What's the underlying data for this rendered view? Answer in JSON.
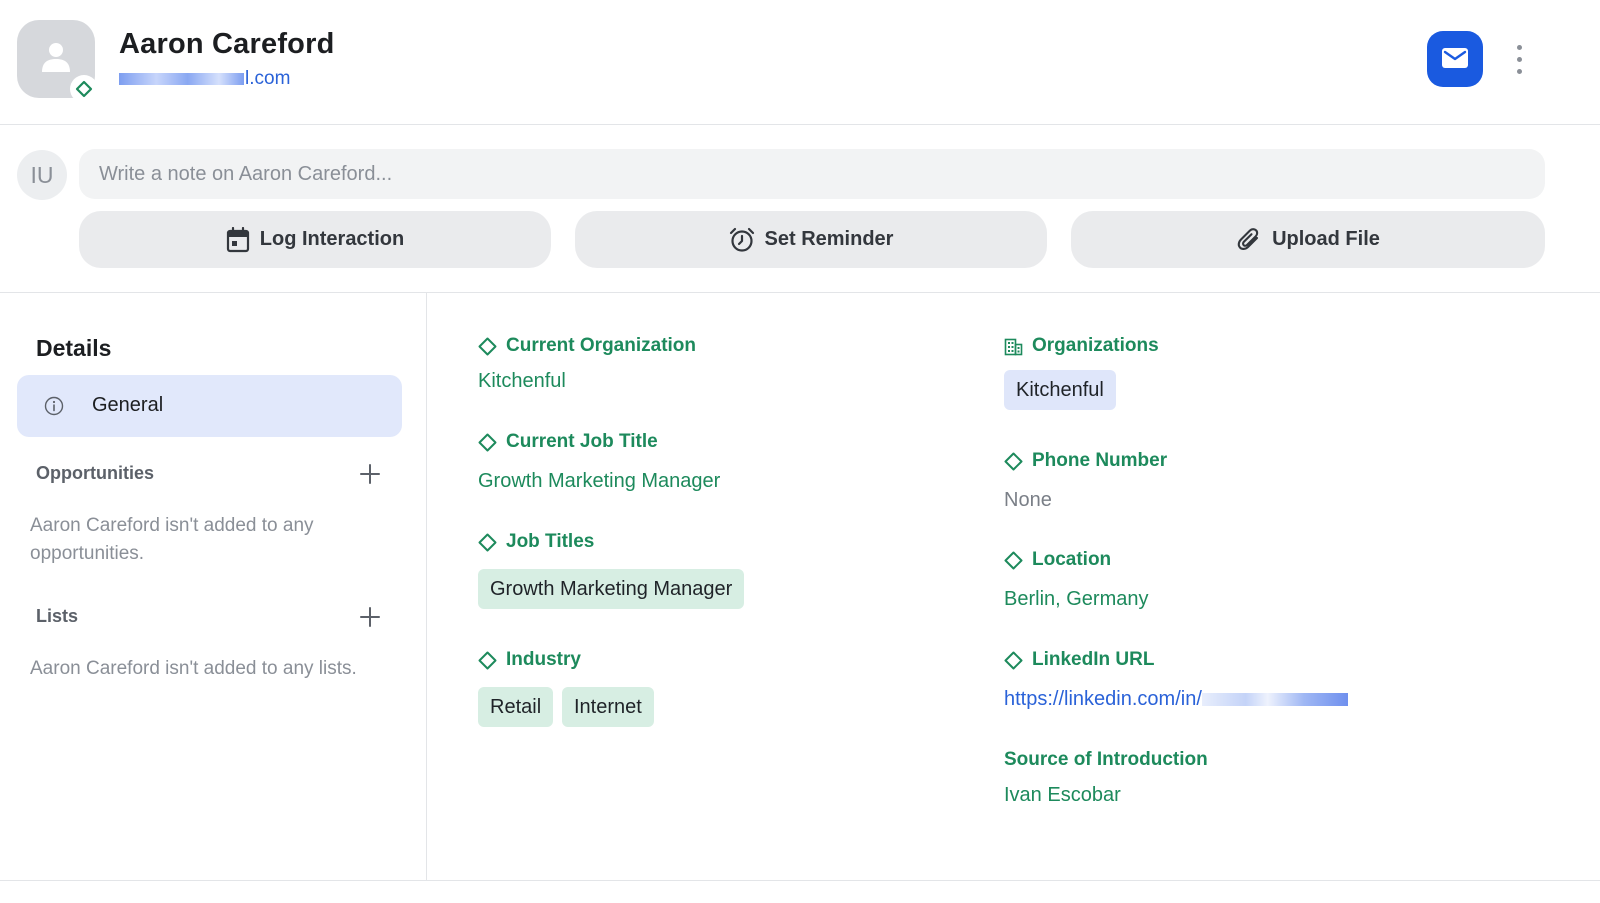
{
  "contact": {
    "name": "Aaron Careford",
    "email_suffix": "l.com"
  },
  "note": {
    "avatar_initials": "IU",
    "placeholder": "Write a note on Aaron Careford..."
  },
  "actions": {
    "log_interaction": "Log Interaction",
    "set_reminder": "Set Reminder",
    "upload_file": "Upload File"
  },
  "sidebar": {
    "title": "Details",
    "general_label": "General",
    "opportunities": {
      "title": "Opportunities",
      "empty_text": "Aaron Careford isn't added to any opportunities."
    },
    "lists": {
      "title": "Lists",
      "empty_text": "Aaron Careford isn't added to any lists."
    }
  },
  "fields": {
    "current_organization": {
      "label": "Current Organization",
      "value": "Kitchenful"
    },
    "current_job_title": {
      "label": "Current Job Title",
      "value": "Growth Marketing Manager"
    },
    "job_titles": {
      "label": "Job Titles",
      "chips": [
        "Growth Marketing Manager"
      ]
    },
    "industry": {
      "label": "Industry",
      "chips": [
        "Retail",
        "Internet"
      ]
    },
    "organizations": {
      "label": "Organizations",
      "chips": [
        "Kitchenful"
      ]
    },
    "phone_number": {
      "label": "Phone Number",
      "value": "None"
    },
    "location": {
      "label": "Location",
      "value": "Berlin, Germany"
    },
    "linkedin_url": {
      "label": "LinkedIn URL",
      "value": "https://linkedin.com/in/"
    },
    "source_of_introduction": {
      "label": "Source of Introduction",
      "value": "Ivan Escobar"
    }
  },
  "colors": {
    "accent_blue": "#1a5ae0",
    "field_green": "#1d8a5c",
    "chip_green": "#d7eee3",
    "chip_blue": "#dfe6fa",
    "selected_nav": "#e1e8fb"
  },
  "icons": {
    "avatar": "person-icon",
    "avatar_badge": "diamond-icon",
    "mail": "mail-icon",
    "more": "more-vertical-icon",
    "log": "calendar-icon",
    "reminder": "alarm-clock-icon",
    "upload": "paperclip-icon",
    "general": "info-icon",
    "add": "plus-icon",
    "organizations": "building-icon"
  }
}
